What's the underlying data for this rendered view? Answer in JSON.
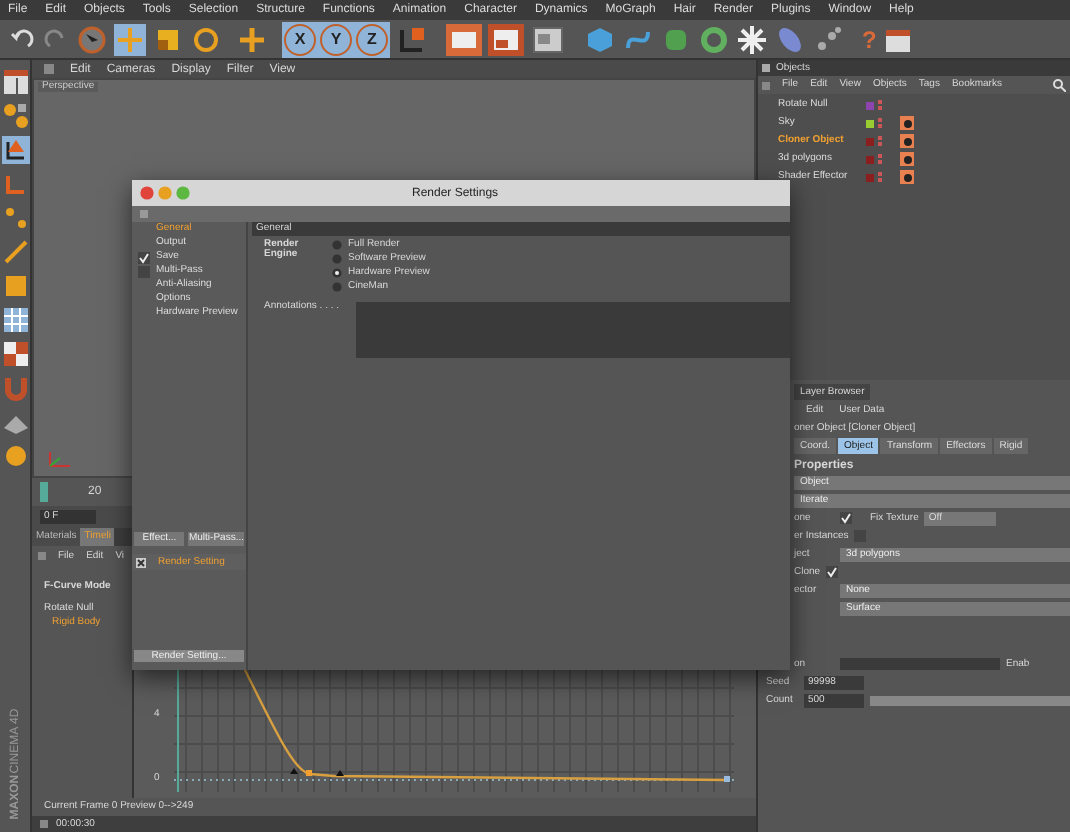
{
  "menu_bar": [
    "File",
    "Edit",
    "Objects",
    "Tools",
    "Selection",
    "Structure",
    "Functions",
    "Animation",
    "Character",
    "Dynamics",
    "MoGraph",
    "Hair",
    "Render",
    "Plugins",
    "Window",
    "Help"
  ],
  "toolbar": {
    "axis_buttons": [
      "X",
      "Y",
      "Z"
    ],
    "help_glyph": "?"
  },
  "viewport": {
    "menu": [
      "Edit",
      "Cameras",
      "Display",
      "Filter",
      "View"
    ],
    "label": "Perspective"
  },
  "time_ruler": {
    "tick": "20",
    "frame_field": "0 F"
  },
  "objects_panel": {
    "title": "Objects",
    "menu": [
      "File",
      "Edit",
      "View",
      "Objects",
      "Tags",
      "Bookmarks"
    ],
    "objects": [
      {
        "name": "Rotate Null",
        "color": "#8e44ad",
        "selected": false
      },
      {
        "name": "Sky",
        "color": "#9acd32",
        "selected": false
      },
      {
        "name": "Cloner Object",
        "color": "#8b1e1e",
        "selected": true
      },
      {
        "name": "3d polygons",
        "color": "#8b1e1e",
        "selected": false
      },
      {
        "name": "Shader Effector",
        "color": "#8b1e1e",
        "selected": false
      }
    ]
  },
  "attributes_panel": {
    "tab": "Layer Browser",
    "menu": [
      "Edit",
      "User Data"
    ],
    "title": "oner Object [Cloner Object]",
    "tabs": [
      {
        "label": "Coord.",
        "selected": false
      },
      {
        "label": "Object",
        "selected": true
      },
      {
        "label": "Transform",
        "selected": false
      },
      {
        "label": "Effectors",
        "selected": false
      },
      {
        "label": "Rigid",
        "selected": false
      }
    ],
    "section": "Properties",
    "object_field": "Object",
    "mode_field": "Iterate",
    "fix_clone_label": "one",
    "fix_clone_checked": true,
    "fix_texture_label": "Fix Texture",
    "fix_texture_value": "Off",
    "instances_label": "er Instances",
    "instances_checked": false,
    "object_label": "ject",
    "object_value": "3d polygons",
    "clone_label": "Clone",
    "clone_checked": true,
    "selector_label": "ector",
    "selector_value": "None",
    "surface_value": "Surface",
    "row_label": "on",
    "enable_label": "Enab",
    "seed_label": "Seed",
    "seed_value": "99998",
    "count_label": "Count",
    "count_value": "500"
  },
  "timeline": {
    "tabs": [
      {
        "label": "Materials",
        "selected": false
      },
      {
        "label": "Timeli",
        "selected": true
      }
    ],
    "menu": [
      "File",
      "Edit",
      "Vi"
    ],
    "mode": "F-Curve Mode",
    "tracks": [
      {
        "name": "Rotate Null",
        "selected": false
      },
      {
        "name": "Rigid Body",
        "selected": true
      }
    ],
    "tick_labels": [
      "4",
      "0"
    ],
    "status": "Current Frame  0  Preview  0-->249",
    "time": "00:00:30"
  },
  "logo": [
    "MAXON",
    "CINEMA 4D"
  ],
  "render_settings": {
    "title": "Render Settings",
    "items": [
      {
        "label": "General",
        "selected": true,
        "kind": "plain"
      },
      {
        "label": "Output",
        "selected": false,
        "kind": "plain"
      },
      {
        "label": "Save",
        "selected": false,
        "kind": "check",
        "checked": true
      },
      {
        "label": "Multi-Pass",
        "selected": false,
        "kind": "check",
        "checked": false
      },
      {
        "label": "Anti-Aliasing",
        "selected": false,
        "kind": "plain"
      },
      {
        "label": "Options",
        "selected": false,
        "kind": "plain"
      },
      {
        "label": "Hardware Preview",
        "selected": false,
        "kind": "plain"
      }
    ],
    "buttons": [
      "Effect...",
      "Multi-Pass..."
    ],
    "setting": "Render Setting",
    "setting_checked": true,
    "bottom_button": "Render Setting...",
    "section": "General",
    "engine_label": "Render Engine",
    "engines": [
      {
        "label": "Full Render",
        "selected": false
      },
      {
        "label": "Software Preview",
        "selected": false
      },
      {
        "label": "Hardware Preview",
        "selected": true
      },
      {
        "label": "CineMan",
        "selected": false
      }
    ],
    "annotations_label": "Annotations . . . ."
  }
}
